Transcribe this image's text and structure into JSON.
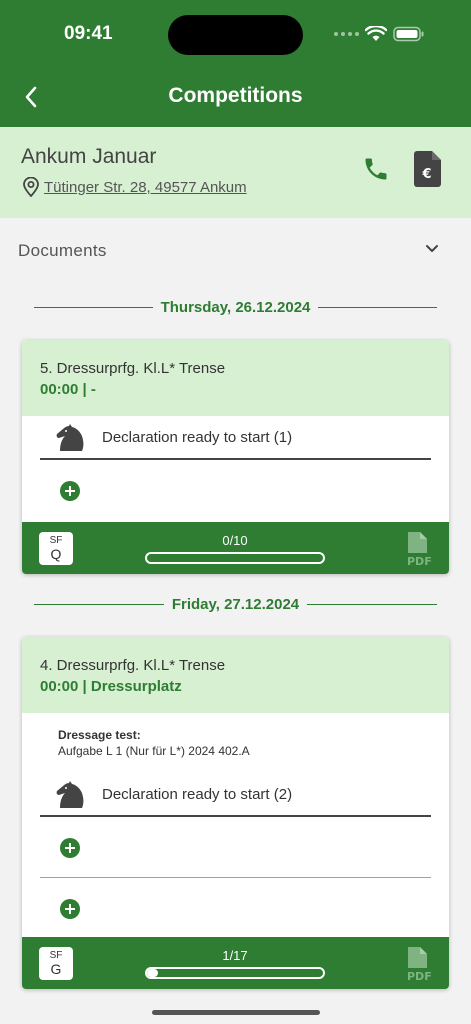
{
  "status_bar": {
    "time": "09:41"
  },
  "header": {
    "title": "Competitions"
  },
  "event": {
    "name": "Ankum Januar",
    "address": "Tütinger Str. 28, 49577 Ankum"
  },
  "documents": {
    "label": "Documents"
  },
  "days": [
    {
      "date": "Thursday, 26.12.2024",
      "competition": {
        "title": "5. Dressurprfg. Kl.L* Trense",
        "time_place": "00:00  | -",
        "declaration": "Declaration ready to start (1)",
        "badge_top": "SF",
        "badge_bottom": "Q",
        "progress_label": "0/10",
        "progress": 0.0,
        "pdf_label": "PDF"
      }
    },
    {
      "date": "Friday, 27.12.2024",
      "competition": {
        "title": "4. Dressurprfg. Kl.L* Trense",
        "time_place": "00:00  | Dressurplatz",
        "dressage_label": "Dressage test:",
        "dressage_value": "Aufgabe L 1 (Nur für L*) 2024 402.A",
        "declaration": "Declaration ready to start (2)",
        "badge_top": "SF",
        "badge_bottom": "G",
        "progress_label": "1/17",
        "progress": 0.06,
        "pdf_label": "PDF"
      }
    }
  ],
  "colors": {
    "primary": "#2e7d32",
    "light_green": "#d7f0d2",
    "background": "#f2f2f2"
  }
}
